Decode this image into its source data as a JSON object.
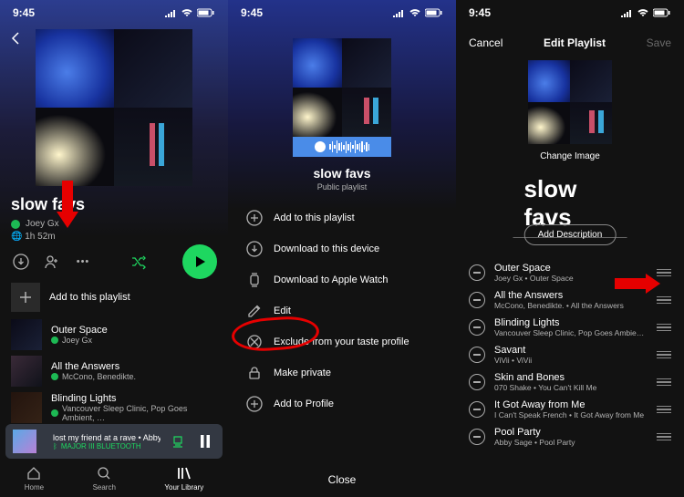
{
  "status": {
    "time": "9:45"
  },
  "playlist": {
    "name": "slow favs",
    "owner": "Joey Gx",
    "duration": "1h 52m",
    "public_label": "Public playlist",
    "add_label": "Add to this playlist"
  },
  "tracks_preview": [
    {
      "title": "Outer Space",
      "artist": "Joey Gx"
    },
    {
      "title": "All the Answers",
      "artist": "McCono, Benedikte."
    },
    {
      "title": "Blinding Lights",
      "artist": "Vancouver Sleep Clinic, Pop Goes Ambient, …"
    }
  ],
  "now_playing": {
    "title": "lost my friend at a rave • Abby Bella Ma…",
    "device": "MAJOR III BLUETOOTH"
  },
  "tabs": {
    "home": "Home",
    "search": "Search",
    "library": "Your Library"
  },
  "menu": {
    "items": [
      {
        "icon": "plus-circle",
        "label": "Add to this playlist"
      },
      {
        "icon": "download",
        "label": "Download to this device"
      },
      {
        "icon": "watch",
        "label": "Download to Apple Watch"
      },
      {
        "icon": "pencil",
        "label": "Edit"
      },
      {
        "icon": "exclude",
        "label": "Exclude from your taste profile"
      },
      {
        "icon": "lock",
        "label": "Make private"
      },
      {
        "icon": "profile-plus",
        "label": "Add to Profile"
      }
    ],
    "close": "Close"
  },
  "edit": {
    "nav_cancel": "Cancel",
    "nav_title": "Edit Playlist",
    "nav_save": "Save",
    "change_image": "Change Image",
    "add_description": "Add Description",
    "tracks": [
      {
        "title": "Outer Space",
        "sub": "Joey Gx • Outer Space"
      },
      {
        "title": "All the Answers",
        "sub": "McCono, Benedikte. • All the Answers"
      },
      {
        "title": "Blinding Lights",
        "sub": "Vancouver Sleep Clinic, Pop Goes Ambient, Am…"
      },
      {
        "title": "Savant",
        "sub": "ViVii • ViVii"
      },
      {
        "title": "Skin and Bones",
        "sub": "070 Shake • You Can't Kill Me"
      },
      {
        "title": "It Got Away from Me",
        "sub": "I Can't Speak French • It Got Away from Me"
      },
      {
        "title": "Pool Party",
        "sub": "Abby Sage • Pool Party"
      }
    ]
  },
  "annotation": {
    "color": "#e60000"
  }
}
